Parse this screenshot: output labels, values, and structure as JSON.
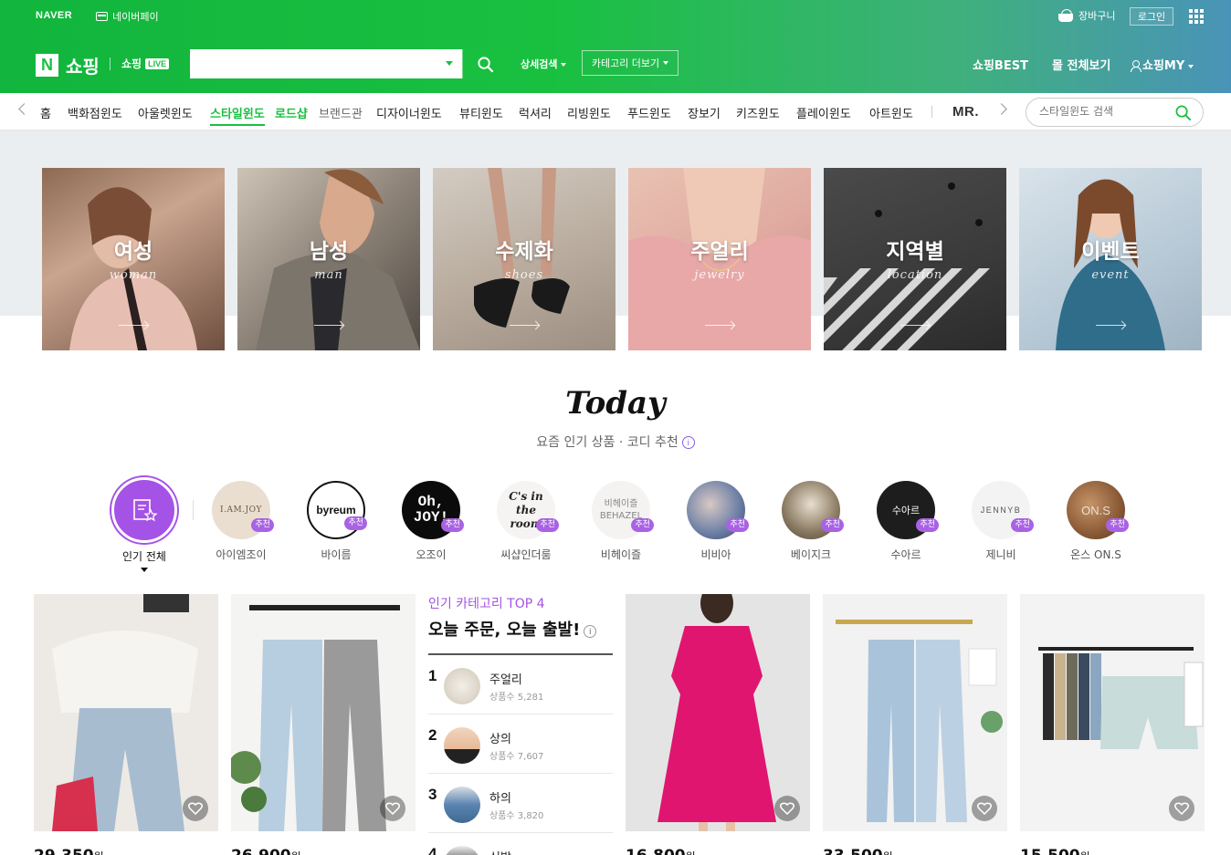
{
  "header": {
    "naver": "NAVER",
    "naverpay": "네이버페이",
    "cart": "장바구니",
    "login": "로그인",
    "shopping": "쇼핑",
    "shopping_live": "쇼핑",
    "live_badge": "LIVE",
    "search_placeholder": "",
    "detail_search": "상세검색",
    "category_more": "카테고리 더보기",
    "shopping_best": "쇼핑BEST",
    "mall_all": "몰 전체보기",
    "shopping_my": "쇼핑MY"
  },
  "nav": {
    "items": [
      "홈",
      "백화점윈도",
      "아울렛윈도",
      "스타일윈도",
      "로드샵",
      "브랜드관",
      "디자이너윈도",
      "뷰티윈도",
      "럭셔리",
      "리빙윈도",
      "푸드윈도",
      "장보기",
      "키즈윈도",
      "플레이윈도",
      "아트윈도"
    ],
    "mr": "MR.",
    "search_placeholder": "스타일윈도 검색"
  },
  "banners": [
    {
      "title": "여성",
      "sub": "woman"
    },
    {
      "title": "남성",
      "sub": "man"
    },
    {
      "title": "수제화",
      "sub": "shoes"
    },
    {
      "title": "주얼리",
      "sub": "jewelry"
    },
    {
      "title": "지역별",
      "sub": "location"
    },
    {
      "title": "이벤트",
      "sub": "event"
    }
  ],
  "today": {
    "title": "Today",
    "subtitle": "요즘 인기 상품 · 코디 추천",
    "info": "i",
    "all_label": "인기 전체",
    "recommend_badge": "추천",
    "brands": [
      {
        "name": "아이엠조이",
        "logo": "I.AM.JOY"
      },
      {
        "name": "바이름",
        "logo": "byreum"
      },
      {
        "name": "오조이",
        "logo": "Oh, JOY!"
      },
      {
        "name": "씨샵인더룸",
        "logo": "C's in the room"
      },
      {
        "name": "비헤이즐",
        "logo": "비헤이즐 BEHAZEL"
      },
      {
        "name": "비비아",
        "logo": ""
      },
      {
        "name": "베이지크",
        "logo": ""
      },
      {
        "name": "수아르",
        "logo": "수아르"
      },
      {
        "name": "제니비",
        "logo": "JENNYB"
      },
      {
        "name": "온스 ON.S",
        "logo": "ON.S"
      }
    ]
  },
  "top4": {
    "kicker": "인기 카테고리 TOP 4",
    "title": "오늘 주문, 오늘 출발!",
    "info": "i",
    "items": [
      {
        "rank": "1",
        "name": "주얼리",
        "count": "상품수 5,281"
      },
      {
        "rank": "2",
        "name": "상의",
        "count": "상품수 7,607"
      },
      {
        "rank": "3",
        "name": "하의",
        "count": "상품수 3,820"
      },
      {
        "rank": "4",
        "name": "신발",
        "count": ""
      }
    ]
  },
  "products": [
    {
      "price": "29,350",
      "unit": "원"
    },
    {
      "price": "26,900",
      "unit": "원"
    },
    {
      "price": "16,800",
      "unit": "원"
    },
    {
      "price": "33,500",
      "unit": "원"
    },
    {
      "price": "15,500",
      "unit": "원"
    }
  ],
  "colors": {
    "naver_green": "#19c040",
    "accent_purple": "#a552e6"
  }
}
